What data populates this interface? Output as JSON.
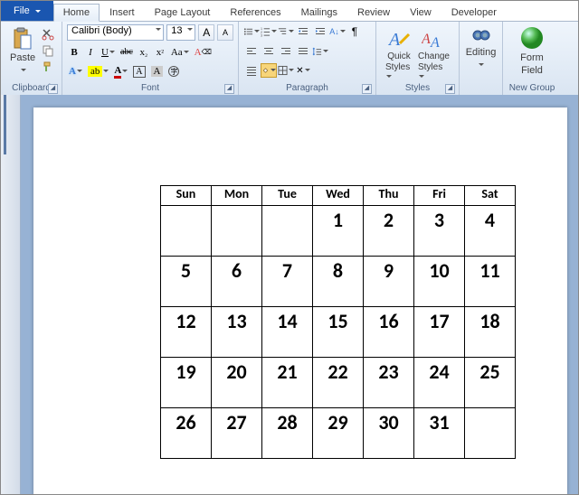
{
  "tabs": {
    "file": "File",
    "home": "Home",
    "insert": "Insert",
    "page_layout": "Page Layout",
    "references": "References",
    "mailings": "Mailings",
    "review": "Review",
    "view": "View",
    "developer": "Developer"
  },
  "groups": {
    "clipboard": "Clipboard",
    "font": "Font",
    "paragraph": "Paragraph",
    "styles": "Styles",
    "editing": "Editing",
    "newgroup": "New Group"
  },
  "clipboard": {
    "paste": "Paste"
  },
  "font": {
    "name": "Calibri (Body)",
    "size": "13",
    "bold": "B",
    "italic": "I",
    "underline": "U",
    "strike": "abc",
    "sub": "x",
    "sub2": "₂",
    "sup": "x",
    "sup2": "²",
    "hl": "ab",
    "fc": "A",
    "grow": "A",
    "shrink": "A",
    "case": "Aa",
    "clear": "A"
  },
  "styles": {
    "quick": "Quick",
    "quick2": "Styles",
    "change": "Change",
    "change2": "Styles"
  },
  "editing": {
    "label": "Editing"
  },
  "newgroup": {
    "form": "Form",
    "field": "Field"
  },
  "calendar": {
    "headers": [
      "Sun",
      "Mon",
      "Tue",
      "Wed",
      "Thu",
      "Fri",
      "Sat"
    ],
    "rows": [
      [
        "",
        "",
        "",
        "1",
        "2",
        "3",
        "4"
      ],
      [
        "5",
        "6",
        "7",
        "8",
        "9",
        "10",
        "11"
      ],
      [
        "12",
        "13",
        "14",
        "15",
        "16",
        "17",
        "18"
      ],
      [
        "19",
        "20",
        "21",
        "22",
        "23",
        "24",
        "25"
      ],
      [
        "26",
        "27",
        "28",
        "29",
        "30",
        "31",
        ""
      ]
    ]
  }
}
